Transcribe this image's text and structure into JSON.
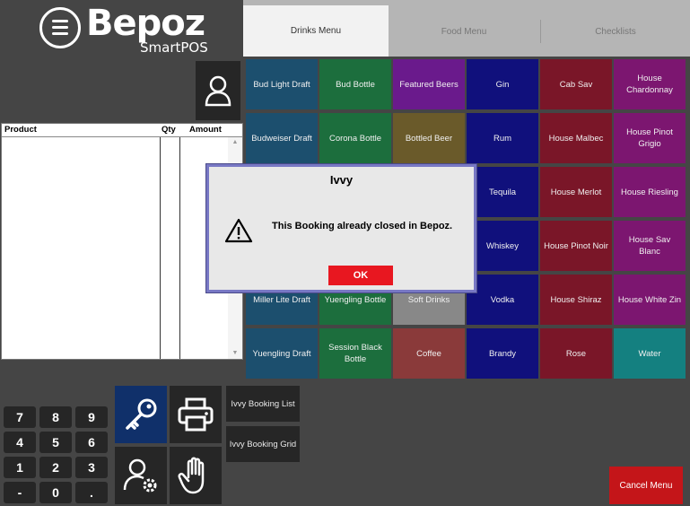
{
  "brand": {
    "name": "Bepoz",
    "sub": "SmartPOS",
    "logo_icon": "menu-circle-icon"
  },
  "tabs": [
    {
      "label": "Drinks Menu",
      "active": true
    },
    {
      "label": "Food Menu",
      "active": false
    },
    {
      "label": "Checklists",
      "active": false
    }
  ],
  "user_icon": "user-icon",
  "product_table": {
    "headers": [
      "Product",
      "Qty",
      "Amount"
    ],
    "rows": []
  },
  "menu_grid": {
    "columns": [
      {
        "color": "#1c4f6e",
        "items": [
          "Bud Light Draft",
          "Budweiser Draft",
          "",
          "",
          "Miller Lite Draft",
          "Yuengling Draft"
        ]
      },
      {
        "color": "#1c6e3d",
        "items": [
          "Bud Bottle",
          "Corona Bottle",
          "",
          "",
          "Yuengling Bottle",
          "Session Black Bottle"
        ]
      },
      {
        "color": "#6a1a8c",
        "items": [
          "Featured Beers",
          "Bottled Beer",
          "",
          "",
          "Soft Drinks",
          "Coffee"
        ]
      },
      {
        "color": "#10107c",
        "items": [
          "Gin",
          "Rum",
          "Tequila",
          "Whiskey",
          "Vodka",
          "Brandy"
        ]
      },
      {
        "color": "#7a1628",
        "items": [
          "Cab Sav",
          "House Malbec",
          "House Merlot",
          "House Pinot Noir",
          "House Shiraz",
          "Rose"
        ]
      },
      {
        "color": "#7c1670",
        "items": [
          "House Chardonnay",
          "House Pinot Grigio",
          "House Riesling",
          "House Sav Blanc",
          "House White Zin",
          "Water"
        ]
      }
    ],
    "special_colors": {
      "bottled_beer": "#6a5a2a",
      "soft_drinks": "#888888",
      "coffee": "#8a3a3a",
      "water": "#148080"
    }
  },
  "numpad": [
    "7",
    "8",
    "9",
    "4",
    "5",
    "6",
    "1",
    "2",
    "3",
    "-",
    "0",
    "."
  ],
  "action_icons": [
    "key-icon",
    "printer-icon",
    "user-settings-icon",
    "hand-icon"
  ],
  "side_buttons": {
    "booking_list": "Ivvy Booking List",
    "booking_grid": "Ivvy Booking Grid"
  },
  "cancel_label": "Cancel Menu",
  "dialog": {
    "title": "Ivvy",
    "icon": "warning-icon",
    "message": "This Booking already closed in Bepoz.",
    "ok_label": "OK"
  }
}
